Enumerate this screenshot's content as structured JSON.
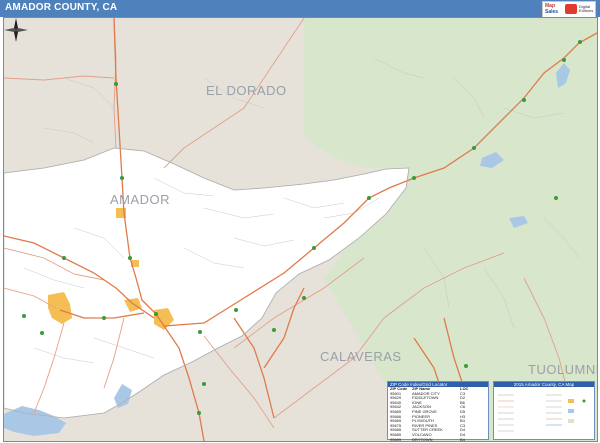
{
  "header": {
    "title": "AMADOR COUNTY, CA",
    "brand_line1": "Map",
    "brand_line2": "Sales",
    "brand_line3": "Digital Editions"
  },
  "map": {
    "county_labels": [
      "EL DORADO",
      "AMADOR",
      "CALAVERAS",
      "TUOLUMNE"
    ],
    "colors": {
      "outside_county": "#e6e2da",
      "amador_county": "#ffffff",
      "forest": "#d8e6cc",
      "water": "#a9c8e6",
      "cities": "#f4be54",
      "highways": "#e07a4a",
      "major_roads": "#e0a08a",
      "minor_roads": "#c8c8c8",
      "highway_shields": "#3a9a3a",
      "title_bar": "#4f81bd"
    }
  },
  "zip_legend": {
    "title": "ZIP Code Index/Grid Locator",
    "columns": [
      "ZIP Code",
      "ZIP Name",
      "LOC"
    ],
    "rows": [
      [
        "95601",
        "AMADOR CITY",
        "C3"
      ],
      [
        "95629",
        "FIDDLETOWN",
        "D2"
      ],
      [
        "95640",
        "IONE",
        "B6"
      ],
      [
        "95642",
        "JACKSON",
        "C6"
      ],
      [
        "95665",
        "PINE GROVE",
        "D5"
      ],
      [
        "95666",
        "PIONEER",
        "H3"
      ],
      [
        "95669",
        "PLYMOUTH",
        "B4"
      ],
      [
        "95675",
        "RIVER PINES",
        "C3"
      ],
      [
        "95685",
        "SUTTER CREEK",
        "D4"
      ],
      [
        "95689",
        "VOLCANO",
        "D4"
      ],
      [
        "95699",
        "DRYTOWN",
        "B4"
      ]
    ]
  },
  "map_key": {
    "title": "2015 Amador County, CA Map"
  }
}
